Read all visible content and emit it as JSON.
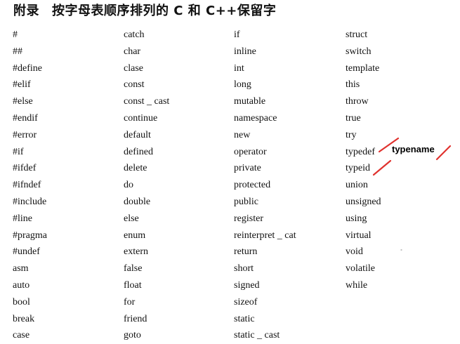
{
  "title": {
    "prefix": "附录",
    "text": "按字母表顺序排列的 C 和 C++保留字"
  },
  "columns": [
    [
      "#",
      "##",
      "#define",
      "#elif",
      "#else",
      "#endif",
      "#error",
      "#if",
      "#ifdef",
      "#ifndef",
      "#include",
      "#line",
      "#pragma",
      "#undef",
      "asm",
      "auto",
      "bool",
      "break",
      "case"
    ],
    [
      "catch",
      "char",
      "clase",
      "const",
      "const _ cast",
      "continue",
      "default",
      "defined",
      "delete",
      "do",
      "double",
      "else",
      "enum",
      "extern",
      "false",
      "float",
      "for",
      "friend",
      "goto"
    ],
    [
      "if",
      "inline",
      "int",
      "long",
      "mutable",
      "namespace",
      "new",
      "operator",
      "private",
      "protected",
      "public",
      "register",
      "reinterpret _ cat",
      "return",
      "short",
      "signed",
      "sizeof",
      "static",
      "static _ cast"
    ],
    [
      "struct",
      "switch",
      "template",
      "this",
      "throw",
      "true",
      "try",
      "typedef",
      "typeid",
      "union",
      "unsigned",
      "using",
      "virtual",
      "void",
      "volatile",
      "while"
    ]
  ],
  "annotation": {
    "text": "typename",
    "stroke_color": "#e0322e"
  }
}
